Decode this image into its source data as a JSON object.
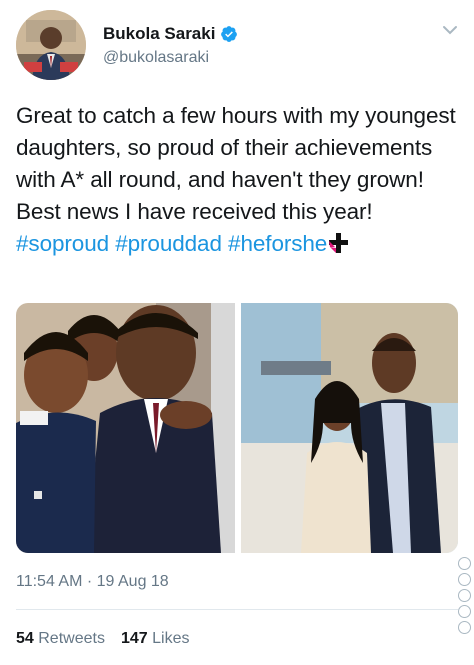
{
  "author": {
    "display_name": "Bukola Saraki",
    "handle": "@bukolasaraki",
    "verified": true,
    "avatar_icon": "profile-photo-avatar"
  },
  "tweet": {
    "text_main": "Great to catch a few hours with my youngest daughters, so proud of their achievements with A* all round, and haven't they grown! Best news I have received this year!",
    "hashtags": [
      "#soproud",
      "#prouddad",
      "#heforshe"
    ],
    "emoji_icon": "heforshe-symbol-icon"
  },
  "media": {
    "photos": [
      {
        "icon": "photo-man-holding-child"
      },
      {
        "icon": "photo-man-with-daughter"
      }
    ]
  },
  "meta": {
    "timestamp": "11:54 AM · 19 Aug 18"
  },
  "stats": {
    "retweets_count": "54",
    "retweets_label": "Retweets",
    "likes_count": "147",
    "likes_label": "Likes"
  },
  "colors": {
    "hashtag": "#1b95e0",
    "verified": "#1da1f2",
    "muted": "#657786",
    "text": "#14171a",
    "divider": "#e1e8ed"
  }
}
